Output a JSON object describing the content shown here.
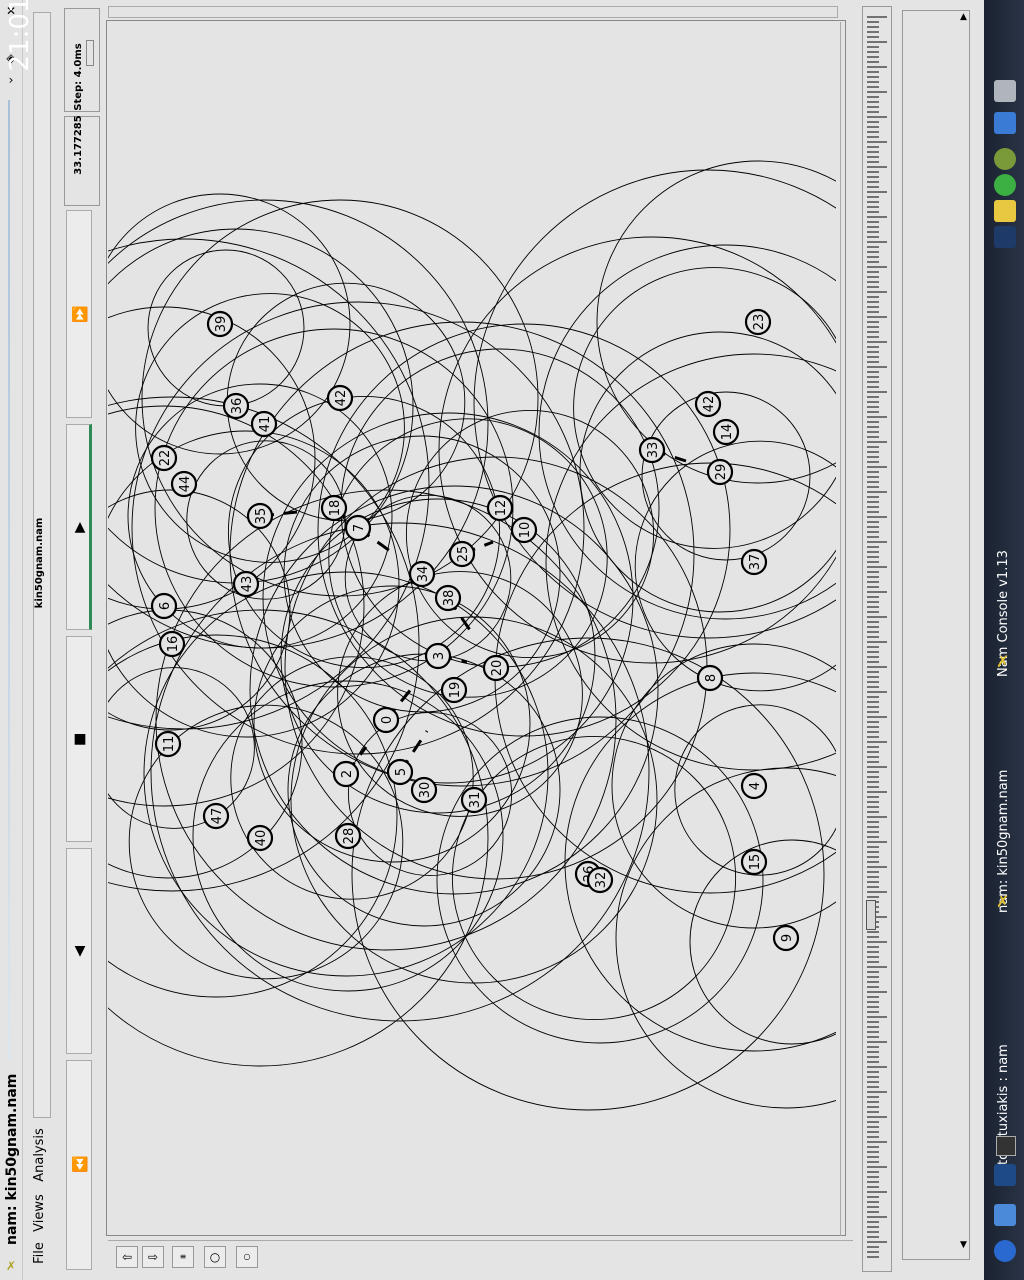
{
  "window": {
    "title": "nam: kin50gnam.nam",
    "file_label": "kin50gnam.nam"
  },
  "menu": {
    "file": "File",
    "views": "Views",
    "analysis": "Analysis"
  },
  "controls": {
    "step_label": "Step: 4.0ms",
    "time_value": "33.177285",
    "rewind_icon": "fast-rewind-icon",
    "back_icon": "play-backward-icon",
    "stop_icon": "stop-icon",
    "play_icon": "play-forward-icon",
    "ff_icon": "fast-forward-icon"
  },
  "nodes": [
    {
      "id": "39"
    },
    {
      "id": "36"
    },
    {
      "id": "41"
    },
    {
      "id": "22"
    },
    {
      "id": "42"
    },
    {
      "id": "44"
    },
    {
      "id": "35"
    },
    {
      "id": "18"
    },
    {
      "id": "7"
    },
    {
      "id": "43"
    },
    {
      "id": "6"
    },
    {
      "id": "16"
    },
    {
      "id": "11"
    },
    {
      "id": "47"
    },
    {
      "id": "40"
    },
    {
      "id": "28"
    },
    {
      "id": "2"
    },
    {
      "id": "5"
    },
    {
      "id": "30"
    },
    {
      "id": "31"
    },
    {
      "id": "0"
    },
    {
      "id": "3"
    },
    {
      "id": "19"
    },
    {
      "id": "20"
    },
    {
      "id": "34"
    },
    {
      "id": "38"
    },
    {
      "id": "25"
    },
    {
      "id": "12"
    },
    {
      "id": "10"
    },
    {
      "id": "33"
    },
    {
      "id": "29"
    },
    {
      "id": "14"
    },
    {
      "id": "42"
    },
    {
      "id": "23"
    },
    {
      "id": "37"
    },
    {
      "id": "8"
    },
    {
      "id": "4"
    },
    {
      "id": "15"
    },
    {
      "id": "26"
    },
    {
      "id": "32"
    },
    {
      "id": "9"
    }
  ],
  "taskbar": {
    "clock": "21:01",
    "tasks": [
      "Nam Console v1.13",
      "nam: kin50gnam.nam",
      "tcl-ptuxiakis : nam"
    ]
  },
  "colors": {
    "background": "#e4e4e4",
    "taskbar": "#1f2838",
    "accent": "#2e8b57"
  }
}
